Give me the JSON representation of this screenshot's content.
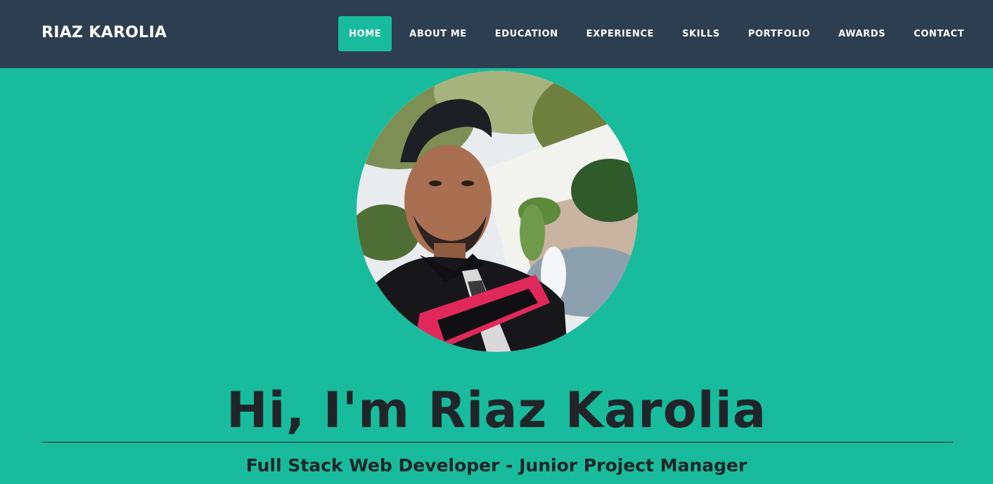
{
  "brand": "RIAZ KAROLIA",
  "nav": {
    "items": [
      {
        "label": "HOME",
        "active": true
      },
      {
        "label": "ABOUT ME",
        "active": false
      },
      {
        "label": "EDUCATION",
        "active": false
      },
      {
        "label": "EXPERIENCE",
        "active": false
      },
      {
        "label": "SKILLS",
        "active": false
      },
      {
        "label": "PORTFOLIO",
        "active": false
      },
      {
        "label": "AWARDS",
        "active": false
      },
      {
        "label": "CONTACT",
        "active": false
      }
    ]
  },
  "hero": {
    "title": "Hi, I'm Riaz Karolia",
    "subtitle": "Full Stack Web Developer - Junior Project Manager"
  },
  "colors": {
    "navbar_bg": "#2c3e50",
    "accent": "#18bc9c",
    "text_dark": "#212529",
    "nav_text": "#ffffff"
  }
}
